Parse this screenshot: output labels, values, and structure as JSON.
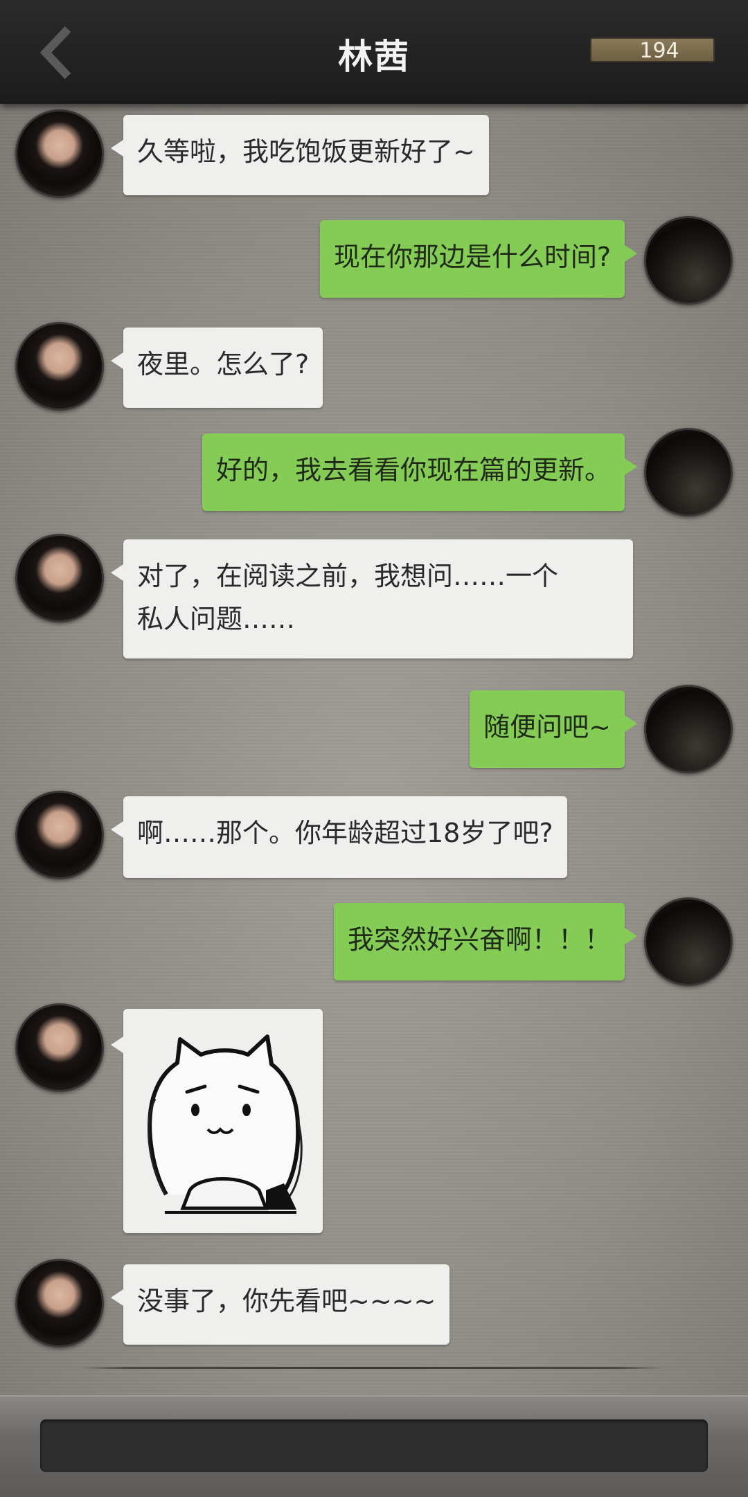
{
  "header": {
    "title": "林茜",
    "coin_count": "194",
    "back_icon": "chevron-left-icon"
  },
  "messages": [
    {
      "from": "her",
      "text": "久等啦，我吃饱饭更新好了~"
    },
    {
      "from": "me",
      "text": "现在你那边是什么时间?"
    },
    {
      "from": "her",
      "text": "夜里。怎么了?"
    },
    {
      "from": "me",
      "text": "好的，我去看看你现在篇的更新。"
    },
    {
      "from": "her",
      "text_line1": "对了，在阅读之前，我想问……一个",
      "text_line2": "私人问题……"
    },
    {
      "from": "me",
      "text": "随便问吧~"
    },
    {
      "from": "her",
      "text": "啊……那个。你年龄超过18岁了吧?"
    },
    {
      "from": "me",
      "text": "我突然好兴奋啊！！！"
    },
    {
      "from": "her",
      "sticker": "cat-sticker"
    },
    {
      "from": "her",
      "text": "没事了，你先看吧~~~~"
    }
  ],
  "composer": {
    "placeholder": ""
  },
  "colors": {
    "header": "#1e1e1e",
    "her_bubble": "#efefed",
    "my_bubble": "#85cc56",
    "coin_box": "#7a6b4c"
  }
}
